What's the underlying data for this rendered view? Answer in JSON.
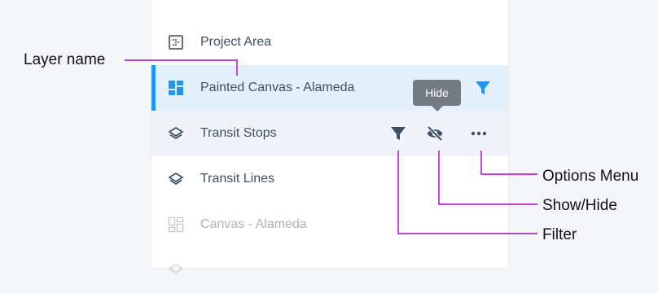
{
  "colors": {
    "accent": "#2196f3",
    "callout_line": "#b000c8",
    "icon": "#3f4f66",
    "icon_faded": "#c5ccd6",
    "selected_bg": "#e3f0fb"
  },
  "layers": [
    {
      "label": "Project Area",
      "icon": "grid-dots-icon"
    },
    {
      "label": "Painted Canvas - Alameda",
      "icon": "dashboard-tiles-icon",
      "selected": true
    },
    {
      "label": "Transit Stops",
      "icon": "layers-icon",
      "hovered": true
    },
    {
      "label": "Transit Lines",
      "icon": "layers-icon"
    },
    {
      "label": "Canvas - Alameda",
      "icon": "dashboard-tiles-outline-icon",
      "hidden": true
    }
  ],
  "tooltip": {
    "text": "Hide"
  },
  "annotations": {
    "layer_name": "Layer name",
    "options_menu": "Options Menu",
    "show_hide": "Show/Hide",
    "filter": "Filter"
  }
}
